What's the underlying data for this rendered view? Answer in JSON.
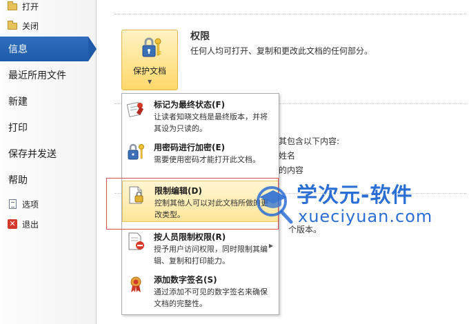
{
  "sidebar": {
    "open_label": "打开",
    "close_label": "关闭",
    "info_label": "信息",
    "recent_label": "最近所用文件",
    "new_label": "新建",
    "print_label": "打印",
    "save_send_label": "保存并发送",
    "help_label": "帮助",
    "options_label": "选项",
    "exit_label": "退出"
  },
  "permissions": {
    "button_label": "保护文档",
    "title": "权限",
    "description": "任何人均可打开、复制和更改此文档的任何部分。"
  },
  "background_fragments": {
    "prepare_line": "意其包含以下内容:",
    "author_fragment": "姓名",
    "content_fragment": "的内容",
    "versions_fragment": "个版本。"
  },
  "menu": {
    "items": [
      {
        "title": "标记为最终状态(F)",
        "desc": "让读者知晓文档是最终版本，并将其设为只读的。",
        "icon": "mark-final-icon"
      },
      {
        "title": "用密码进行加密(E)",
        "desc": "需要使用密码才能打开此文档。",
        "icon": "encrypt-keys-icon"
      },
      {
        "title": "限制编辑(D)",
        "desc": "控制其他人可以对此文档所做的更改类型。",
        "icon": "restrict-editing-icon"
      },
      {
        "title": "按人员限制权限(R)",
        "desc": "授予用户访问权限，同时限制其编辑、复制和打印能力。",
        "icon": "restrict-by-people-icon"
      },
      {
        "title": "添加数字签名(S)",
        "desc": "通过添加不可见的数字签名来确保文档的完整性。",
        "icon": "digital-signature-icon"
      }
    ]
  },
  "watermark": {
    "title": "学次元-软件",
    "url": "xueciyuan.com"
  },
  "colors": {
    "nav_active": "#1e5aa8",
    "menu_highlight": "#fde59a",
    "watermark": "#2c6fd4",
    "annotation_box": "#e05050"
  }
}
